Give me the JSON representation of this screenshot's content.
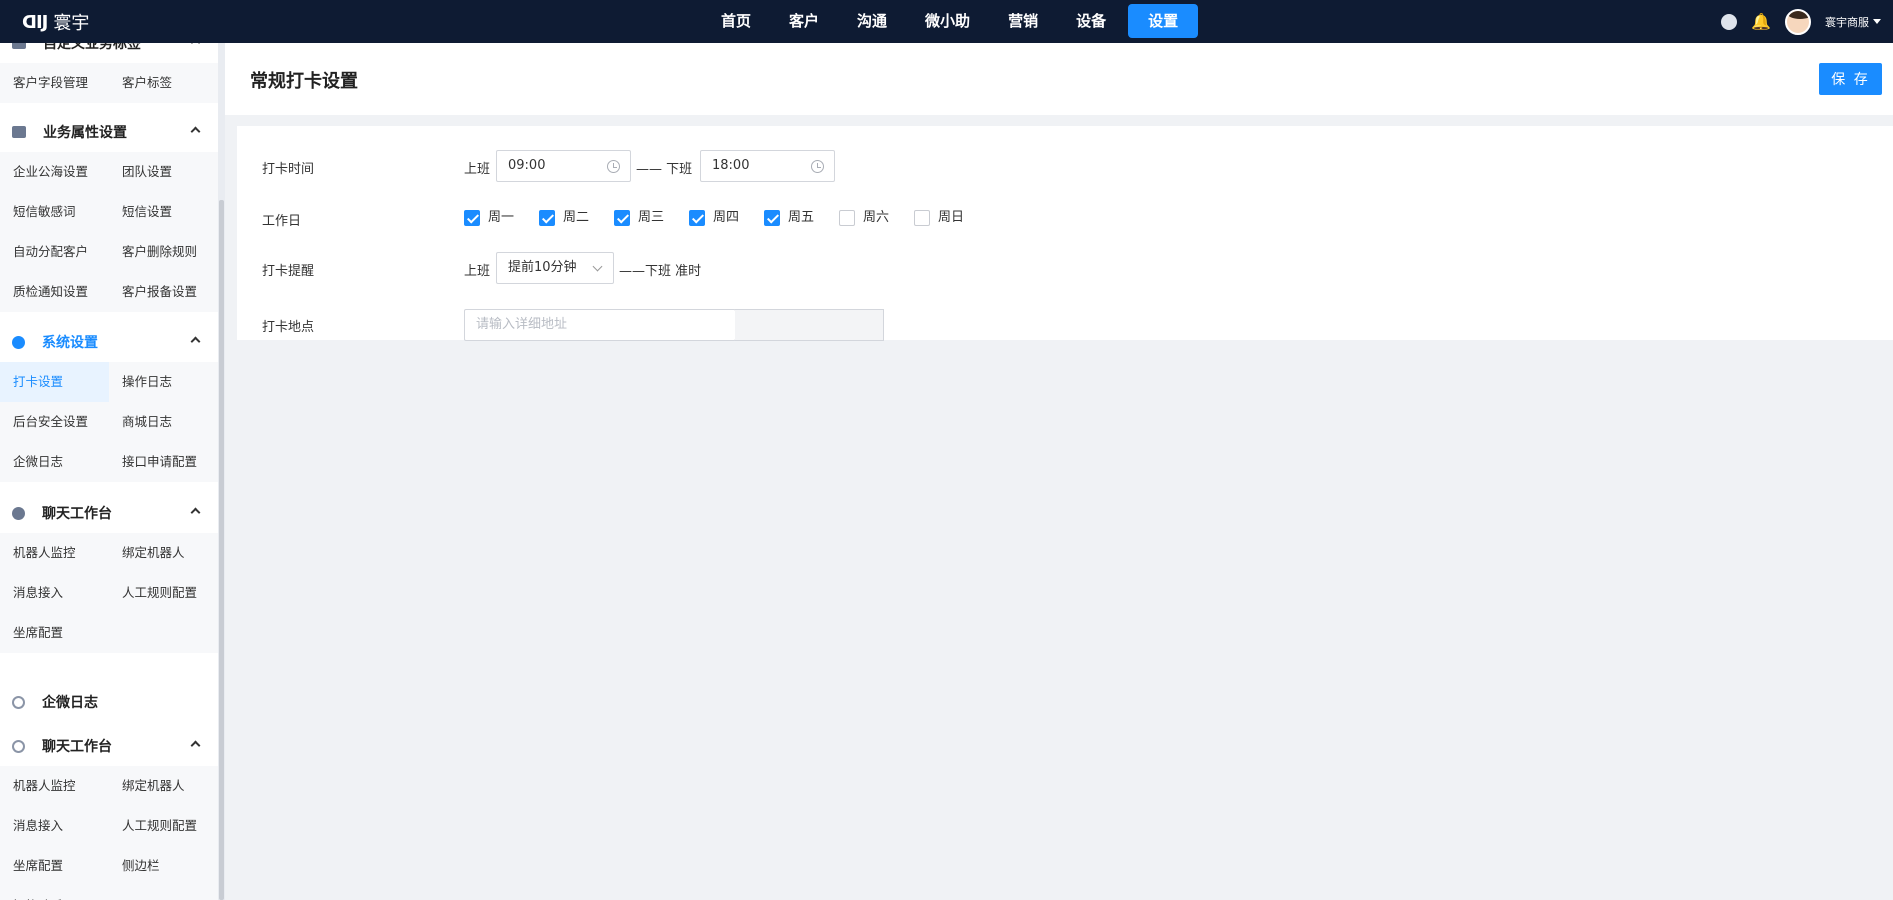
{
  "app": {
    "logo_mark": "ᗡIJ",
    "logo_text": "寰宇"
  },
  "nav": {
    "items": [
      "首页",
      "客户",
      "沟通",
      "微小助",
      "营销",
      "设备",
      "设置"
    ],
    "active_index": 6
  },
  "user": {
    "name": "寰宇商服"
  },
  "sidebar": {
    "partial_group": {
      "title": "自定义业务标签",
      "items": [
        "客户字段管理",
        "客户标签"
      ]
    },
    "groups": [
      {
        "title": "业务属性设置",
        "icon": "briefcase-icon",
        "items": [
          "企业公海设置",
          "团队设置",
          "短信敏感词",
          "短信设置",
          "自动分配客户",
          "客户删除规则",
          "质检通知设置",
          "客户报备设置"
        ]
      },
      {
        "title": "系统设置",
        "icon": "settings-icon",
        "active": true,
        "items": [
          "打卡设置",
          "操作日志",
          "后台安全设置",
          "商城日志",
          "企微日志",
          "接口申请配置"
        ],
        "active_item": "打卡设置"
      },
      {
        "title": "聊天工作台",
        "icon": "chat-icon",
        "items": [
          "机器人监控",
          "绑定机器人",
          "消息接入",
          "人工规则配置",
          "坐席配置"
        ]
      },
      {
        "title": "企微日志",
        "icon": "ring-icon",
        "items": []
      },
      {
        "title": "聊天工作台",
        "icon": "ring-icon",
        "items": [
          "机器人监控",
          "绑定机器人",
          "消息接入",
          "人工规则配置",
          "坐席配置",
          "侧边栏",
          "智能助手"
        ]
      }
    ]
  },
  "page": {
    "title": "常规打卡设置",
    "save_label": "保 存"
  },
  "form": {
    "time": {
      "label": "打卡时间",
      "start_label": "上班",
      "start_value": "09:00",
      "separator": "—— 下班",
      "end_value": "18:00"
    },
    "workdays": {
      "label": "工作日",
      "days": [
        {
          "name": "周一",
          "checked": true
        },
        {
          "name": "周二",
          "checked": true
        },
        {
          "name": "周三",
          "checked": true
        },
        {
          "name": "周四",
          "checked": true
        },
        {
          "name": "周五",
          "checked": true
        },
        {
          "name": "周六",
          "checked": false
        },
        {
          "name": "周日",
          "checked": false
        }
      ]
    },
    "reminder": {
      "label": "打卡提醒",
      "start_label": "上班",
      "selected": "提前10分钟",
      "suffix": "——下班 准时"
    },
    "location": {
      "label": "打卡地点",
      "placeholder": "请输入详细地址"
    }
  },
  "colors": {
    "topbar": "#0e1b33",
    "accent": "#1a8cff"
  }
}
